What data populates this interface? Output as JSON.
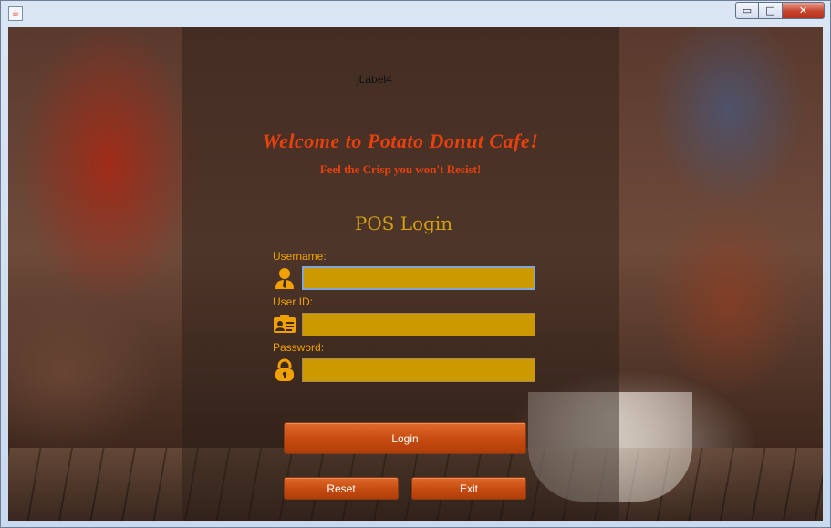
{
  "window": {
    "title": "",
    "controls": {
      "minimize": "▭",
      "maximize": "□",
      "close": "✕"
    }
  },
  "header": {
    "jlabel": "jLabel4",
    "welcome": "Welcome to Potato Donut Cafe!",
    "tagline": "Feel the Crisp you won't Resist!",
    "pos_title": "POS Login"
  },
  "form": {
    "username": {
      "label": "Username:",
      "value": "",
      "icon": "person-icon"
    },
    "userid": {
      "label": "User ID:",
      "value": "",
      "icon": "id-card-icon"
    },
    "password": {
      "label": "Password:",
      "value": "",
      "icon": "lock-icon"
    }
  },
  "buttons": {
    "login": "Login",
    "reset": "Reset",
    "exit": "Exit"
  },
  "colors": {
    "accent": "#e8400f",
    "label": "#f0a000",
    "field_bg": "#cc9900",
    "button": "#c64a10"
  }
}
